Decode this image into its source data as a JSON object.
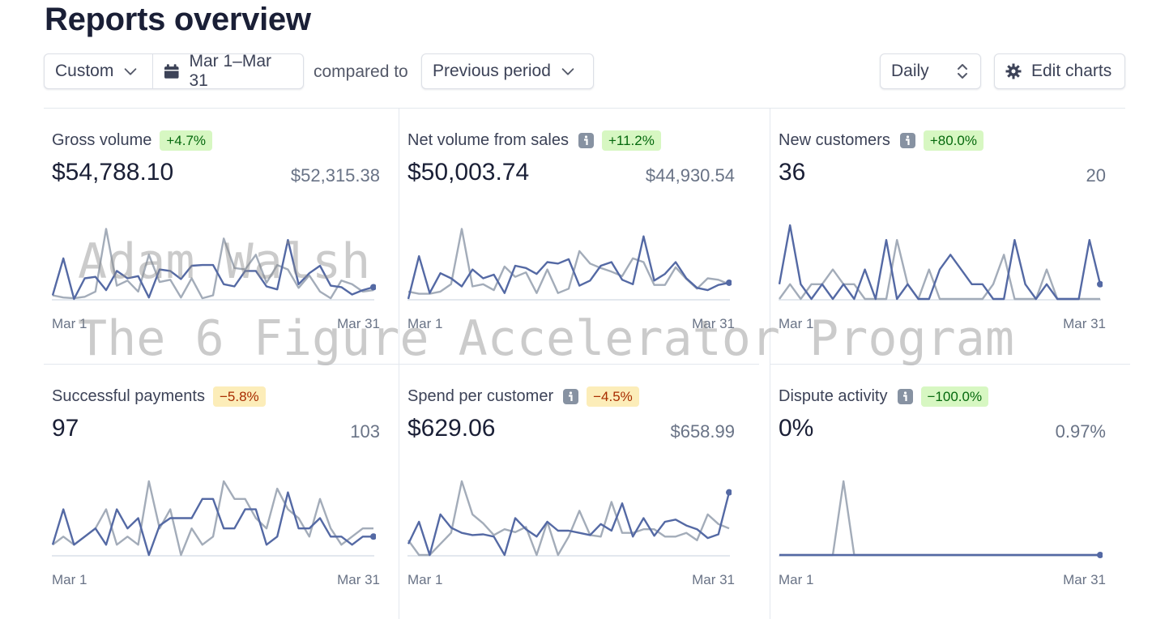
{
  "page": {
    "title": "Reports overview"
  },
  "toolbar": {
    "range_preset": "Custom",
    "date_range": "Mar 1–Mar 31",
    "compared_to_label": "compared to",
    "comparison": "Previous period",
    "interval": "Daily",
    "edit_charts": "Edit charts"
  },
  "icons": {
    "range_preset": "chevron-down-icon",
    "date_range": "calendar-icon",
    "comparison": "chevron-down-icon",
    "interval": "up-down-chevron-icon",
    "edit_charts": "gear-icon",
    "info": "info-icon"
  },
  "colors": {
    "current_series": "#5469a4",
    "previous_series": "#a3acb9",
    "positive_badge_bg": "#d7f7c2",
    "positive_badge_text": "#05690d",
    "negative_badge_bg": "#fcedb9",
    "negative_badge_text": "#a82c00"
  },
  "watermark": {
    "line1": "Adam Walsh",
    "line2": "The 6 Figure Accelerator Program"
  },
  "cards": [
    {
      "title": "Gross volume",
      "info": false,
      "change": "+4.7%",
      "trend": "pos",
      "value": "$54,788.10",
      "previous": "$52,315.38",
      "x_start": "Mar 1",
      "x_end": "Mar 31"
    },
    {
      "title": "Net volume from sales",
      "info": true,
      "change": "+11.2%",
      "trend": "pos",
      "value": "$50,003.74",
      "previous": "$44,930.54",
      "x_start": "Mar 1",
      "x_end": "Mar 31"
    },
    {
      "title": "New customers",
      "info": true,
      "change": "+80.0%",
      "trend": "pos",
      "value": "36",
      "previous": "20",
      "x_start": "Mar 1",
      "x_end": "Mar 31"
    },
    {
      "title": "Successful payments",
      "info": false,
      "change": "−5.8%",
      "trend": "neg",
      "value": "97",
      "previous": "103",
      "x_start": "Mar 1",
      "x_end": "Mar 31"
    },
    {
      "title": "Spend per customer",
      "info": true,
      "change": "−4.5%",
      "trend": "neg",
      "value": "$629.06",
      "previous": "$658.99",
      "x_start": "Mar 1",
      "x_end": "Mar 31"
    },
    {
      "title": "Dispute activity",
      "info": true,
      "change": "−100.0%",
      "trend": "pos",
      "value": "0%",
      "previous": "0.97%",
      "x_start": "Mar 1",
      "x_end": "Mar 31"
    }
  ],
  "chart_data": [
    {
      "type": "line",
      "title": "Gross volume",
      "x": [
        "Mar 1",
        "Mar 31"
      ],
      "days": 31,
      "ylim": [
        0,
        100
      ],
      "series": [
        {
          "name": "current",
          "values": [
            5,
            55,
            0,
            28,
            30,
            12,
            38,
            28,
            31,
            2,
            40,
            38,
            27,
            45,
            46,
            46,
            20,
            17,
            38,
            38,
            17,
            13,
            80,
            20,
            35,
            45,
            18,
            16,
            6,
            12,
            16
          ]
        },
        {
          "name": "previous",
          "values": [
            5,
            2,
            1,
            3,
            10,
            95,
            18,
            25,
            10,
            60,
            23,
            26,
            2,
            28,
            1,
            5,
            82,
            42,
            40,
            60,
            22,
            46,
            40,
            15,
            32,
            10,
            1,
            25,
            20,
            10,
            12
          ]
        }
      ]
    },
    {
      "title": "Net volume from sales",
      "type": "line",
      "days": 31,
      "ylim": [
        0,
        100
      ],
      "series": [
        {
          "name": "current",
          "values": [
            0,
            58,
            8,
            35,
            28,
            17,
            40,
            28,
            33,
            8,
            45,
            42,
            34,
            50,
            48,
            54,
            18,
            25,
            45,
            50,
            26,
            20,
            85,
            25,
            34,
            50,
            28,
            15,
            12,
            19,
            22
          ]
        },
        {
          "name": "previous",
          "values": [
            10,
            7,
            7,
            10,
            20,
            95,
            17,
            20,
            12,
            44,
            30,
            36,
            8,
            40,
            8,
            14,
            65,
            48,
            42,
            37,
            31,
            55,
            50,
            19,
            19,
            43,
            27,
            14,
            28,
            26,
            20
          ]
        }
      ]
    },
    {
      "title": "New customers",
      "type": "line",
      "days": 31,
      "ylim": [
        0,
        100
      ],
      "series": [
        {
          "name": "current",
          "values": [
            20,
            100,
            20,
            0,
            20,
            0,
            20,
            0,
            40,
            0,
            80,
            0,
            20,
            0,
            0,
            40,
            60,
            40,
            20,
            20,
            0,
            0,
            80,
            20,
            0,
            20,
            0,
            0,
            0,
            80,
            20
          ]
        },
        {
          "name": "previous",
          "values": [
            0,
            20,
            0,
            20,
            20,
            40,
            20,
            20,
            0,
            0,
            0,
            80,
            20,
            0,
            40,
            0,
            0,
            0,
            0,
            0,
            20,
            60,
            0,
            0,
            0,
            40,
            0,
            0,
            0,
            0,
            0
          ]
        }
      ]
    },
    {
      "title": "Successful payments",
      "type": "line",
      "days": 31,
      "ylim": [
        0,
        100
      ],
      "series": [
        {
          "name": "current",
          "values": [
            14,
            62,
            14,
            25,
            36,
            14,
            62,
            36,
            50,
            0,
            40,
            50,
            50,
            50,
            76,
            76,
            36,
            36,
            62,
            62,
            14,
            25,
            85,
            36,
            36,
            50,
            25,
            25,
            14,
            25,
            25
          ]
        },
        {
          "name": "previous",
          "values": [
            14,
            25,
            14,
            25,
            36,
            62,
            14,
            25,
            14,
            100,
            36,
            62,
            0,
            36,
            14,
            25,
            100,
            76,
            76,
            50,
            36,
            90,
            62,
            50,
            25,
            76,
            36,
            14,
            25,
            36,
            36
          ]
        }
      ]
    },
    {
      "title": "Spend per customer",
      "type": "line",
      "days": 31,
      "ylim": [
        0,
        100
      ],
      "series": [
        {
          "name": "current",
          "values": [
            15,
            45,
            0,
            55,
            37,
            30,
            27,
            28,
            25,
            0,
            50,
            35,
            25,
            45,
            33,
            33,
            30,
            27,
            42,
            33,
            70,
            25,
            50,
            26,
            45,
            48,
            40,
            35,
            23,
            28,
            85
          ]
        },
        {
          "name": "previous",
          "values": [
            20,
            0,
            0,
            15,
            30,
            100,
            55,
            43,
            27,
            35,
            31,
            38,
            0,
            45,
            0,
            25,
            60,
            27,
            25,
            72,
            30,
            30,
            35,
            35,
            25,
            25,
            30,
            20,
            55,
            42,
            36
          ]
        }
      ]
    },
    {
      "title": "Dispute activity",
      "type": "line",
      "days": 31,
      "ylim": [
        0,
        100
      ],
      "series": [
        {
          "name": "current",
          "values": [
            0,
            0,
            0,
            0,
            0,
            0,
            0,
            0,
            0,
            0,
            0,
            0,
            0,
            0,
            0,
            0,
            0,
            0,
            0,
            0,
            0,
            0,
            0,
            0,
            0,
            0,
            0,
            0,
            0,
            0,
            0
          ]
        },
        {
          "name": "previous",
          "values": [
            0,
            0,
            0,
            0,
            0,
            0,
            100,
            0,
            0,
            0,
            0,
            0,
            0,
            0,
            0,
            0,
            0,
            0,
            0,
            0,
            0,
            0,
            0,
            0,
            0,
            0,
            0,
            0,
            0,
            0,
            0
          ]
        }
      ]
    }
  ]
}
